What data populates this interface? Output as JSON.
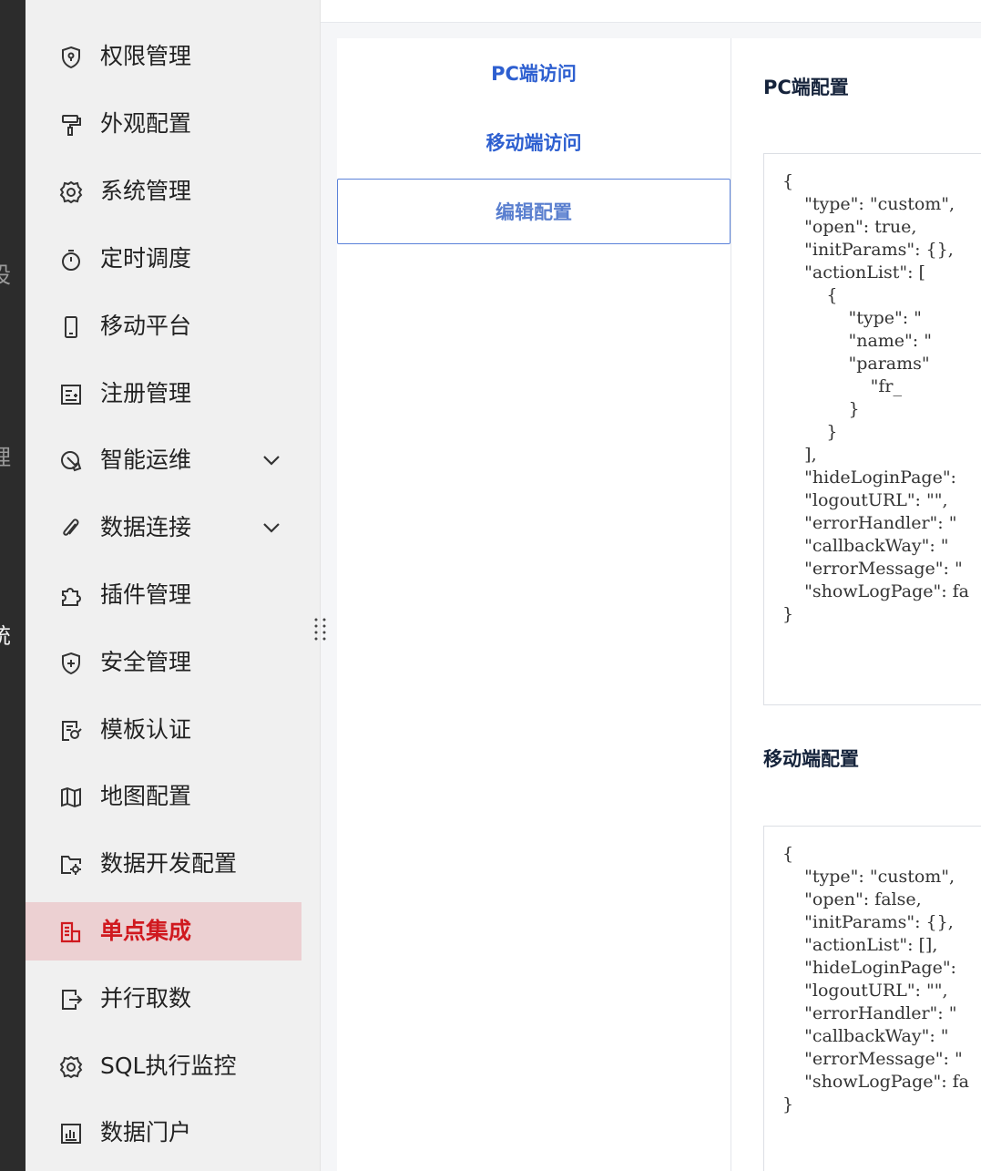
{
  "rail": {
    "chars": [
      "设",
      "理",
      "统"
    ]
  },
  "sidebar": {
    "items": [
      {
        "label": "权限管理",
        "icon": "shield-lock-icon"
      },
      {
        "label": "外观配置",
        "icon": "paint-roller-icon"
      },
      {
        "label": "系统管理",
        "icon": "gear-icon"
      },
      {
        "label": "定时调度",
        "icon": "stopwatch-icon"
      },
      {
        "label": "移动平台",
        "icon": "mobile-icon"
      },
      {
        "label": "注册管理",
        "icon": "register-icon"
      },
      {
        "label": "智能运维",
        "icon": "wrench-icon",
        "expandable": true
      },
      {
        "label": "数据连接",
        "icon": "paperclip-icon",
        "expandable": true
      },
      {
        "label": "插件管理",
        "icon": "puzzle-icon"
      },
      {
        "label": "安全管理",
        "icon": "shield-plus-icon"
      },
      {
        "label": "模板认证",
        "icon": "certificate-icon"
      },
      {
        "label": "地图配置",
        "icon": "map-icon"
      },
      {
        "label": "数据开发配置",
        "icon": "folder-gear-icon"
      },
      {
        "label": "单点集成",
        "icon": "sso-icon",
        "active": true
      },
      {
        "label": "并行取数",
        "icon": "export-icon"
      },
      {
        "label": "SQL执行监控",
        "icon": "gear-icon"
      },
      {
        "label": "数据门户",
        "icon": "chart-icon"
      }
    ],
    "active_color": "#d0191f",
    "active_bg": "#ecd0d2"
  },
  "tabs": [
    {
      "label": "PC端访问"
    },
    {
      "label": "移动端访问"
    },
    {
      "label": "编辑配置",
      "selected": true
    }
  ],
  "pc_section": {
    "title": "PC端配置",
    "code": "{\n    \"type\": \"custom\",\n    \"open\": true,\n    \"initParams\": {},\n    \"actionList\": [\n        {\n            \"type\": \"\n            \"name\": \"\n            \"params\"\n                \"fr_\n            }\n        }\n    ],\n    \"hideLoginPage\":\n    \"logoutURL\": \"\",\n    \"errorHandler\": \"\n    \"callbackWay\": \"\n    \"errorMessage\": \"\n    \"showLogPage\": fa\n}"
  },
  "mobile_section": {
    "title": "移动端配置",
    "code": "{\n    \"type\": \"custom\",\n    \"open\": false,\n    \"initParams\": {},\n    \"actionList\": [],\n    \"hideLoginPage\":\n    \"logoutURL\": \"\",\n    \"errorHandler\": \"\n    \"callbackWay\": \"\n    \"errorMessage\": \"\n    \"showLogPage\": fa\n}"
  },
  "accent_color": "#2d5fd0"
}
